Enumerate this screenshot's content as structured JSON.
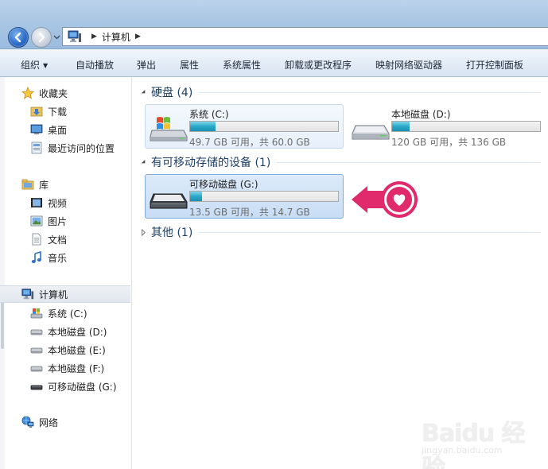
{
  "address": {
    "root_crumb": "计算机"
  },
  "toolbar": {
    "organize": "组织",
    "autoplay": "自动播放",
    "eject": "弹出",
    "properties": "属性",
    "system_properties": "系统属性",
    "uninstall": "卸载或更改程序",
    "map_drive": "映射网络驱动器",
    "control_panel": "打开控制面板"
  },
  "sidebar": {
    "favorites": {
      "label": "收藏夹",
      "items": [
        {
          "label": "下载",
          "icon": "download-folder-icon"
        },
        {
          "label": "桌面",
          "icon": "desktop-icon"
        },
        {
          "label": "最近访问的位置",
          "icon": "recent-places-icon"
        }
      ]
    },
    "libraries": {
      "label": "库",
      "items": [
        {
          "label": "视频",
          "icon": "video-library-icon"
        },
        {
          "label": "图片",
          "icon": "pictures-library-icon"
        },
        {
          "label": "文档",
          "icon": "documents-library-icon"
        },
        {
          "label": "音乐",
          "icon": "music-library-icon"
        }
      ]
    },
    "computer": {
      "label": "计算机",
      "items": [
        {
          "label": "系统 (C:)",
          "icon": "system-drive-icon"
        },
        {
          "label": "本地磁盘 (D:)",
          "icon": "local-disk-icon"
        },
        {
          "label": "本地磁盘 (E:)",
          "icon": "local-disk-icon"
        },
        {
          "label": "本地磁盘 (F:)",
          "icon": "local-disk-icon"
        },
        {
          "label": "可移动磁盘 (G:)",
          "icon": "removable-disk-icon"
        }
      ]
    },
    "network": {
      "label": "网络"
    }
  },
  "content": {
    "groups": [
      {
        "title": "硬盘 (4)",
        "expanded": true
      },
      {
        "title": "有可移动存储的设备 (1)",
        "expanded": true
      },
      {
        "title": "其他 (1)",
        "expanded": false
      }
    ],
    "drives": [
      {
        "name": "系统 (C:)",
        "size": "49.7 GB 可用，共 60.0 GB",
        "used_fraction": 0.17,
        "icon": "windows-system-drive-icon"
      },
      {
        "name": "本地磁盘 (D:)",
        "size": "120 GB 可用，共 136 GB",
        "used_fraction": 0.12,
        "icon": "hard-disk-icon"
      },
      {
        "name": "可移动磁盘 (G:)",
        "size": "13.5 GB 可用，共 14.7 GB",
        "used_fraction": 0.08,
        "icon": "removable-disk-icon"
      }
    ]
  },
  "watermark": {
    "main": "Baidu 经验",
    "sub": "jingyan.baidu.com"
  },
  "colors": {
    "accent_heart": "#e02a6b",
    "drive_bar": "#2ba8c8",
    "group_title": "#1e3f66",
    "toolbar_bg": "#e4ecf6"
  }
}
